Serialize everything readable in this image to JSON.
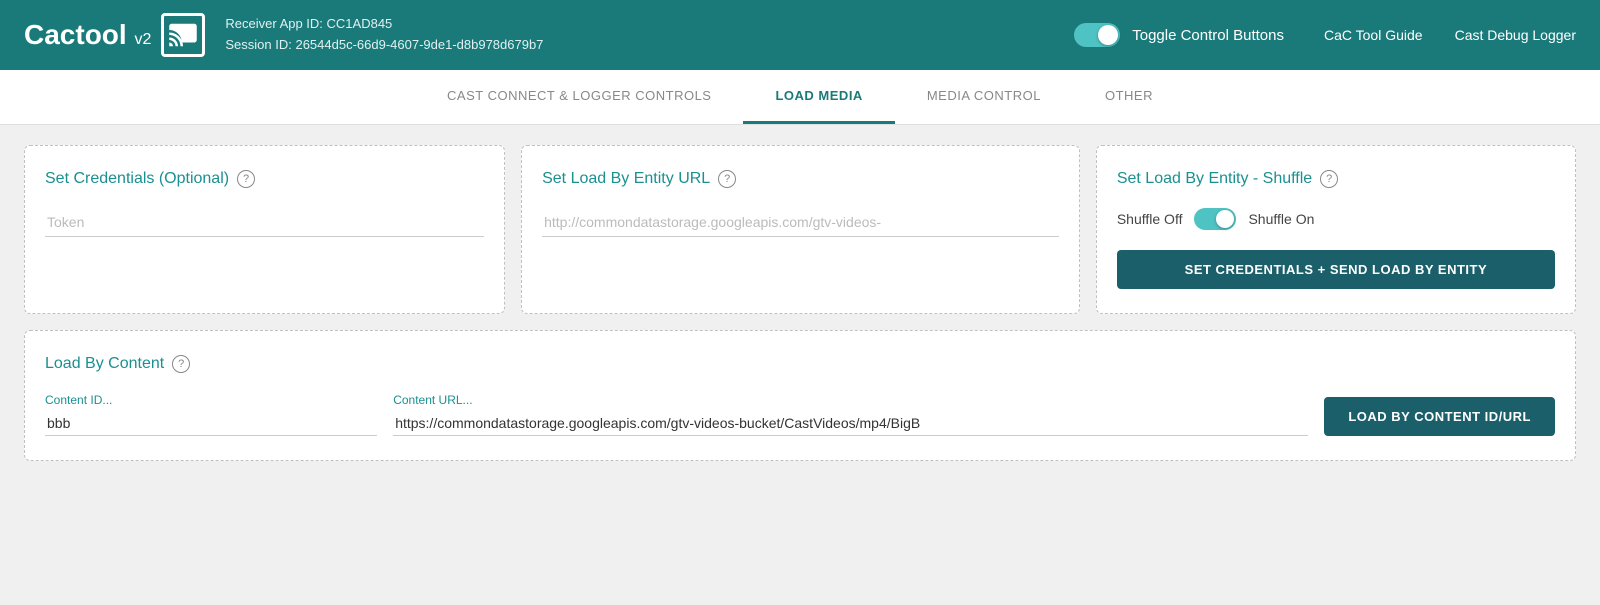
{
  "header": {
    "logo_text": "Cactool",
    "logo_version": "v2",
    "receiver_label": "Receiver App ID: CC1AD845",
    "session_label": "Session ID: 26544d5c-66d9-4607-9de1-d8b978d679b7",
    "toggle_label": "Toggle Control Buttons",
    "link_guide": "CaC Tool Guide",
    "link_logger": "Cast Debug Logger"
  },
  "tabs": [
    {
      "id": "cast-connect",
      "label": "CAST CONNECT & LOGGER CONTROLS",
      "active": false
    },
    {
      "id": "load-media",
      "label": "LOAD MEDIA",
      "active": true
    },
    {
      "id": "media-control",
      "label": "MEDIA CONTROL",
      "active": false
    },
    {
      "id": "other",
      "label": "OTHER",
      "active": false
    }
  ],
  "cards": {
    "credentials": {
      "title": "Set Credentials (Optional)",
      "token_placeholder": "Token"
    },
    "entity_url": {
      "title": "Set Load By Entity URL",
      "url_placeholder": "http://commondatastorage.googleapis.com/gtv-videos-"
    },
    "shuffle": {
      "title": "Set Load By Entity - Shuffle",
      "shuffle_off": "Shuffle Off",
      "shuffle_on": "Shuffle On",
      "button_label": "SET CREDENTIALS + SEND LOAD BY ENTITY"
    }
  },
  "load_content": {
    "title": "Load By Content",
    "content_id_label": "Content ID...",
    "content_id_value": "bbb",
    "content_url_label": "Content URL...",
    "content_url_value": "https://commondatastorage.googleapis.com/gtv-videos-bucket/CastVideos/mp4/BigB",
    "button_label": "LOAD BY CONTENT ID/URL"
  },
  "colors": {
    "teal_dark": "#1a7a7a",
    "teal_accent": "#1a9090",
    "button_dark": "#1a5f6a"
  }
}
